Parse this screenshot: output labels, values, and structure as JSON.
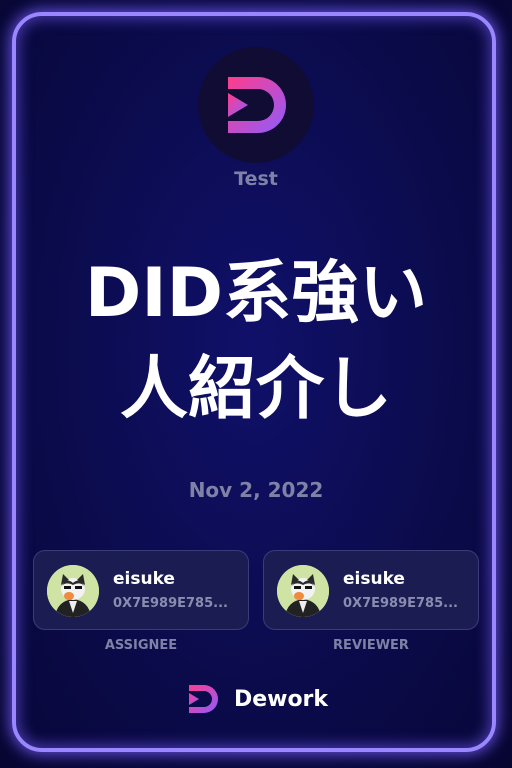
{
  "workspace": {
    "name": "Test",
    "logo_icon": "dework-logo-icon"
  },
  "task": {
    "title_line1": "DID系強い",
    "title_line2": "人紹介し",
    "date": "Nov 2, 2022"
  },
  "assignee": {
    "name": "eisuke",
    "address": "0X7E989E785...",
    "role": "ASSIGNEE",
    "avatar_icon": "cat-avatar-icon"
  },
  "reviewer": {
    "name": "eisuke",
    "address": "0X7E989E785...",
    "role": "REVIEWER",
    "avatar_icon": "cat-avatar-icon"
  },
  "brand": {
    "name": "Dework",
    "logo_icon": "dework-logo-icon"
  },
  "colors": {
    "background": "#0a0a44",
    "frame_glow": "#9a86ff",
    "logo_pink": "#ff3d8b",
    "logo_purple": "#8e5bff",
    "muted_text": "#7f82a6",
    "card_bg": "#1b1c52"
  }
}
